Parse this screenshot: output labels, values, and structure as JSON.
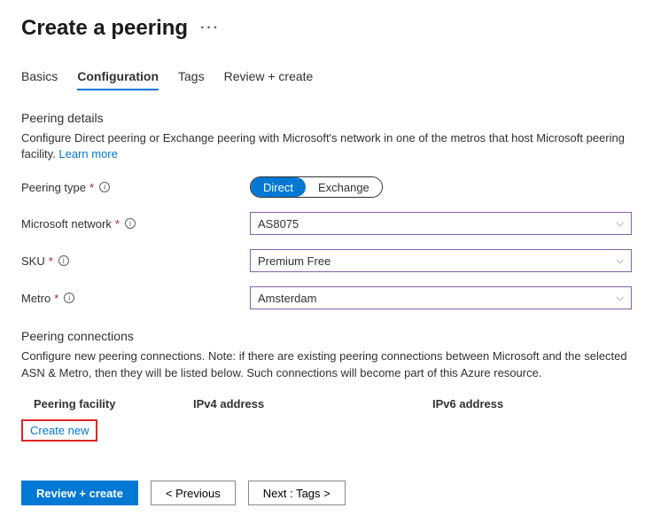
{
  "header": {
    "title": "Create a peering"
  },
  "tabs": [
    {
      "label": "Basics"
    },
    {
      "label": "Configuration",
      "active": true
    },
    {
      "label": "Tags"
    },
    {
      "label": "Review + create"
    }
  ],
  "peering_details": {
    "heading": "Peering details",
    "description": "Configure Direct peering or Exchange peering with Microsoft's network in one of the metros that host Microsoft peering facility. ",
    "learn_more": "Learn more"
  },
  "fields": {
    "peering_type": {
      "label": "Peering type",
      "options": [
        "Direct",
        "Exchange"
      ],
      "selected": "Direct"
    },
    "microsoft_network": {
      "label": "Microsoft network",
      "value": "AS8075"
    },
    "sku": {
      "label": "SKU",
      "value": "Premium Free"
    },
    "metro": {
      "label": "Metro",
      "value": "Amsterdam"
    }
  },
  "peering_connections": {
    "heading": "Peering connections",
    "description": "Configure new peering connections. Note: if there are existing peering connections between Microsoft and the selected ASN & Metro, then they will be listed below. Such connections will become part of this Azure resource.",
    "columns": [
      "Peering facility",
      "IPv4 address",
      "IPv6 address"
    ],
    "create_new": "Create new"
  },
  "footer": {
    "review": "Review + create",
    "previous": "< Previous",
    "next": "Next : Tags >"
  }
}
